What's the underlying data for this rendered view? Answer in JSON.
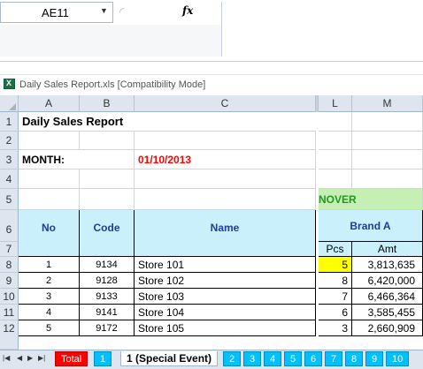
{
  "formula_bar": {
    "name_box": "AE11",
    "fx_label": "fx",
    "formula": ""
  },
  "window": {
    "title": "Daily Sales Report.xls  [Compatibility Mode]"
  },
  "columns": [
    "A",
    "B",
    "C",
    "L",
    "M"
  ],
  "rows": [
    "1",
    "2",
    "3",
    "4",
    "5",
    "6",
    "7",
    "8",
    "9",
    "10",
    "11",
    "12"
  ],
  "sheet": {
    "title": "Daily Sales Report",
    "month_label": "MONTH:",
    "month_value": "01/10/2013",
    "turnover_label": "NOVER",
    "header": {
      "no": "No",
      "code": "Code",
      "name": "Name",
      "brand": "Brand A",
      "pcs": "Pcs",
      "amt": "Amt"
    },
    "data": [
      {
        "no": "1",
        "code": "9134",
        "name": "Store 101",
        "pcs": "5",
        "amt": "3,813,635"
      },
      {
        "no": "2",
        "code": "9128",
        "name": "Store 102",
        "pcs": "8",
        "amt": "6,420,000"
      },
      {
        "no": "3",
        "code": "9133",
        "name": "Store 103",
        "pcs": "7",
        "amt": "6,466,364"
      },
      {
        "no": "4",
        "code": "9141",
        "name": "Store 104",
        "pcs": "6",
        "amt": "3,585,455"
      },
      {
        "no": "5",
        "code": "9172",
        "name": "Store 105",
        "pcs": "3",
        "amt": "2,660,909"
      }
    ]
  },
  "tabs": [
    "Total",
    "1",
    "1 (Special Event)",
    "2",
    "3",
    "4",
    "5",
    "6",
    "7",
    "8",
    "9",
    "10"
  ],
  "colors": {
    "header_blue": "#c9f0fb",
    "turnover_green": "#c6efb5",
    "month_red": "#ff0000",
    "highlight_yellow": "#ffff00",
    "tab_red": "#ff0000",
    "tab_blue": "#00c0ff"
  }
}
